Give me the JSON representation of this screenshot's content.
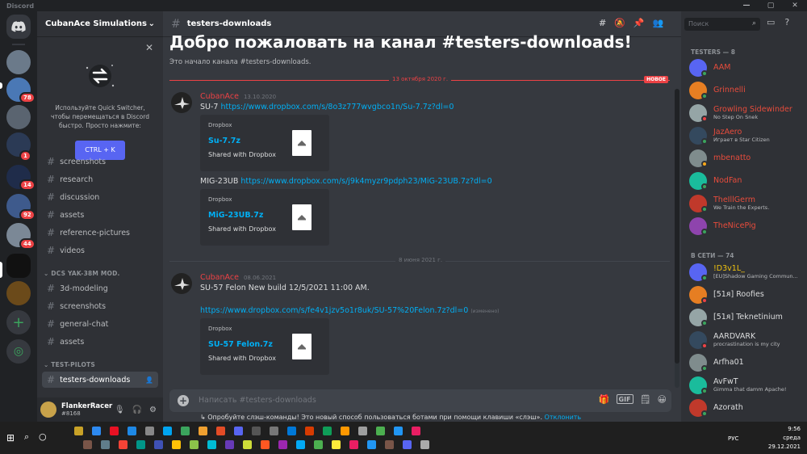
{
  "window": {
    "title": "Discord",
    "controls": [
      "—",
      "▢",
      "✕"
    ]
  },
  "servers": {
    "badges": [
      "78",
      "1",
      "14",
      "92",
      "44"
    ]
  },
  "sidebar": {
    "guild_name": "CubanAce Simulations",
    "quick_switcher": {
      "text": "Используйте Quick Switcher, чтобы перемещаться в Discord быстро. Просто нажмите:",
      "shortcut": "CTRL + K"
    },
    "channels_top": [
      "screenshots",
      "research",
      "discussion",
      "assets",
      "reference-pictures",
      "videos"
    ],
    "category_yak": "DCS YAK-38M MOD.",
    "channels_yak": [
      "3d-modeling",
      "screenshots",
      "general-chat",
      "assets"
    ],
    "category_test": "TEST-PILOTS",
    "active_channel": "testers-downloads"
  },
  "user": {
    "name": "FlankerRacer",
    "tag": "#8168"
  },
  "channel": {
    "name": "testers-downloads",
    "welcome_title": "Добро пожаловать на канал #testers-downloads!",
    "welcome_sub": "Это начало канала #testers-downloads."
  },
  "messages": {
    "divider1": "13 октября 2020 г.",
    "new_label": "НОВОЕ",
    "m1": {
      "author": "CubanAce",
      "time": "13.10.2020",
      "line1_prefix": "SU-7 ",
      "line1_link": "https://www.dropbox.com/s/8o3z777wvgbco1n/Su-7.7z?dl=0",
      "embed1": {
        "provider": "Dropbox",
        "title": "Su-7.7z",
        "sub": "Shared with Dropbox"
      },
      "line2_prefix": "MIG-23UB ",
      "line2_link": "https://www.dropbox.com/s/j9k4myzr9pdph23/MiG-23UB.7z?dl=0",
      "embed2": {
        "provider": "Dropbox",
        "title": "MiG-23UB.7z",
        "sub": "Shared with Dropbox"
      }
    },
    "divider2": "8 июня 2021 г.",
    "m2": {
      "author": "CubanAce",
      "time": "08.06.2021",
      "line1": "SU-57 Felon New build 12/5/2021 11:00 AM.",
      "link": "https://www.dropbox.com/s/fe4v1jzv5o1r8uk/SU-57%20Felon.7z?dl=0",
      "edited": "(изменено)",
      "embed": {
        "provider": "Dropbox",
        "title": "SU-57 Felon.7z",
        "sub": "Shared with Dropbox"
      }
    }
  },
  "composer": {
    "placeholder": "Написать #testers-downloads",
    "gif": "GIF",
    "hint": "Опробуйте слэш-команды! Это новый способ пользоваться ботами при помощи клавиши «слэш».",
    "hint_dismiss": "Отклонить"
  },
  "members": {
    "search_placeholder": "Поиск",
    "group1": "TESTERS — 8",
    "testers": [
      {
        "name": "AAM",
        "activity": "",
        "color": "#e74c3c",
        "status": "#3ba55d"
      },
      {
        "name": "Grinnelli",
        "activity": "",
        "color": "#e74c3c",
        "status": "#3ba55d"
      },
      {
        "name": "Growling Sidewinder",
        "activity": "No Step On Snek",
        "color": "#e74c3c",
        "status": "#ed4245"
      },
      {
        "name": "JazAero",
        "activity": "Играет в Star Citizen",
        "color": "#e74c3c",
        "status": "#3ba55d"
      },
      {
        "name": "mbenatto",
        "activity": "",
        "color": "#e74c3c",
        "status": "#faa81a"
      },
      {
        "name": "NodFan",
        "activity": "",
        "color": "#e74c3c",
        "status": "#3ba55d"
      },
      {
        "name": "TheIllGerm",
        "activity": "We Train the Experts.",
        "color": "#e74c3c",
        "status": "#3ba55d"
      },
      {
        "name": "TheNicePig",
        "activity": "",
        "color": "#e74c3c",
        "status": "#3ba55d"
      }
    ],
    "group2": "В СЕТИ — 74",
    "online": [
      {
        "name": "!D3v1L_",
        "activity": "[EU]Shadow Gaming Commun...",
        "color": "#f1c40f",
        "status": "#3ba55d"
      },
      {
        "name": "[51ᴙ] Roofies",
        "activity": "",
        "color": "#dcddde",
        "status": "#ed4245"
      },
      {
        "name": "[51ᴙ] Teknetinium",
        "activity": "",
        "color": "#dcddde",
        "status": "#3ba55d"
      },
      {
        "name": "AARDVARK",
        "activity": "procrastination is my city",
        "color": "#dcddde",
        "status": "#ed4245"
      },
      {
        "name": "Arfha01",
        "activity": "",
        "color": "#dcddde",
        "status": "#3ba55d"
      },
      {
        "name": "AvFwT",
        "activity": "Gimma that damm Apache!",
        "color": "#dcddde",
        "status": "#3ba55d"
      },
      {
        "name": "Azorath",
        "activity": "",
        "color": "#dcddde",
        "status": "#3ba55d"
      }
    ]
  },
  "taskbar": {
    "lang": "РУС",
    "time": "9:56",
    "day": "среда",
    "date": "29.12.2021"
  }
}
